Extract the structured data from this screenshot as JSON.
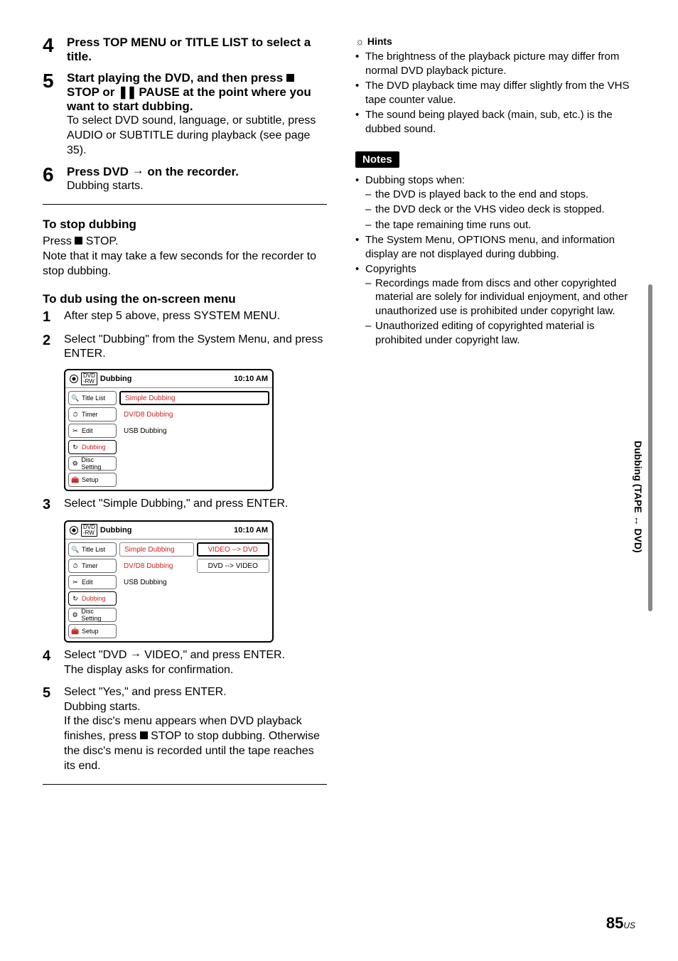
{
  "left": {
    "step4": "Press TOP MENU or TITLE LIST to select a title.",
    "step5_title": "Start playing the DVD, and then press ",
    "step5_title_b": " STOP or ",
    "step5_title_c": " PAUSE at the point where you want to start dubbing.",
    "step5_text": "To select DVD sound, language, or subtitle, press AUDIO or SUBTITLE during playback (see page 35).",
    "step6_title_a": "Press DVD ",
    "step6_title_b": " on the recorder.",
    "step6_text": "Dubbing starts.",
    "stop_hdr": "To stop dubbing",
    "stop_text_a": "Press ",
    "stop_text_b": " STOP.",
    "stop_text_c": "Note that it may take a few seconds for the recorder to stop dubbing.",
    "dub_hdr": "To dub using the on-screen menu",
    "sub1": "After step 5 above, press SYSTEM MENU.",
    "sub2": "Select \"Dubbing\" from the System Menu, and press ENTER.",
    "sub3": "Select \"Simple Dubbing,\" and press ENTER.",
    "sub4_a": "Select \"DVD ",
    "sub4_b": " VIDEO,\" and press ENTER.",
    "sub4_c": "The display asks for confirmation.",
    "sub5_a": "Select \"Yes,\" and press ENTER.",
    "sub5_b": "Dubbing starts.",
    "sub5_c": "If the disc's menu appears when DVD playback finishes, press ",
    "sub5_d": " STOP to stop dubbing. Otherwise the disc's menu is recorded until the tape reaches its end."
  },
  "menu": {
    "title": "Dubbing",
    "time": "10:10 AM",
    "side": [
      "Title List",
      "Timer",
      "Edit",
      "Dubbing",
      "Disc Setting",
      "Setup"
    ],
    "opts": [
      "Simple Dubbing",
      "DV/D8 Dubbing",
      "USB Dubbing"
    ],
    "opts2_right": [
      "VIDEO --> DVD",
      "DVD     --> VIDEO"
    ]
  },
  "right": {
    "hints_label": "Hints",
    "hints": [
      "The brightness of the playback picture may differ from normal DVD playback picture.",
      "The DVD playback time may differ slightly from the VHS tape counter value.",
      "The sound being played back (main, sub, etc.) is the dubbed sound."
    ],
    "notes_label": "Notes",
    "note1": "Dubbing stops when:",
    "note1_sub": [
      "the DVD is played back to the end and stops.",
      "the DVD deck or the VHS video deck is stopped.",
      "the tape remaining time runs out."
    ],
    "note2": "The System Menu, OPTIONS menu, and information display are not displayed during dubbing.",
    "note3": "Copyrights",
    "note3_sub": [
      "Recordings made from discs and other copyrighted material are solely for individual enjoyment, and other unauthorized use is prohibited under copyright law.",
      "Unauthorized editing of copyrighted material is prohibited under copyright law."
    ]
  },
  "side_tab": "Dubbing (TAPE ↔ DVD)",
  "page": "85",
  "page_suffix": "US"
}
